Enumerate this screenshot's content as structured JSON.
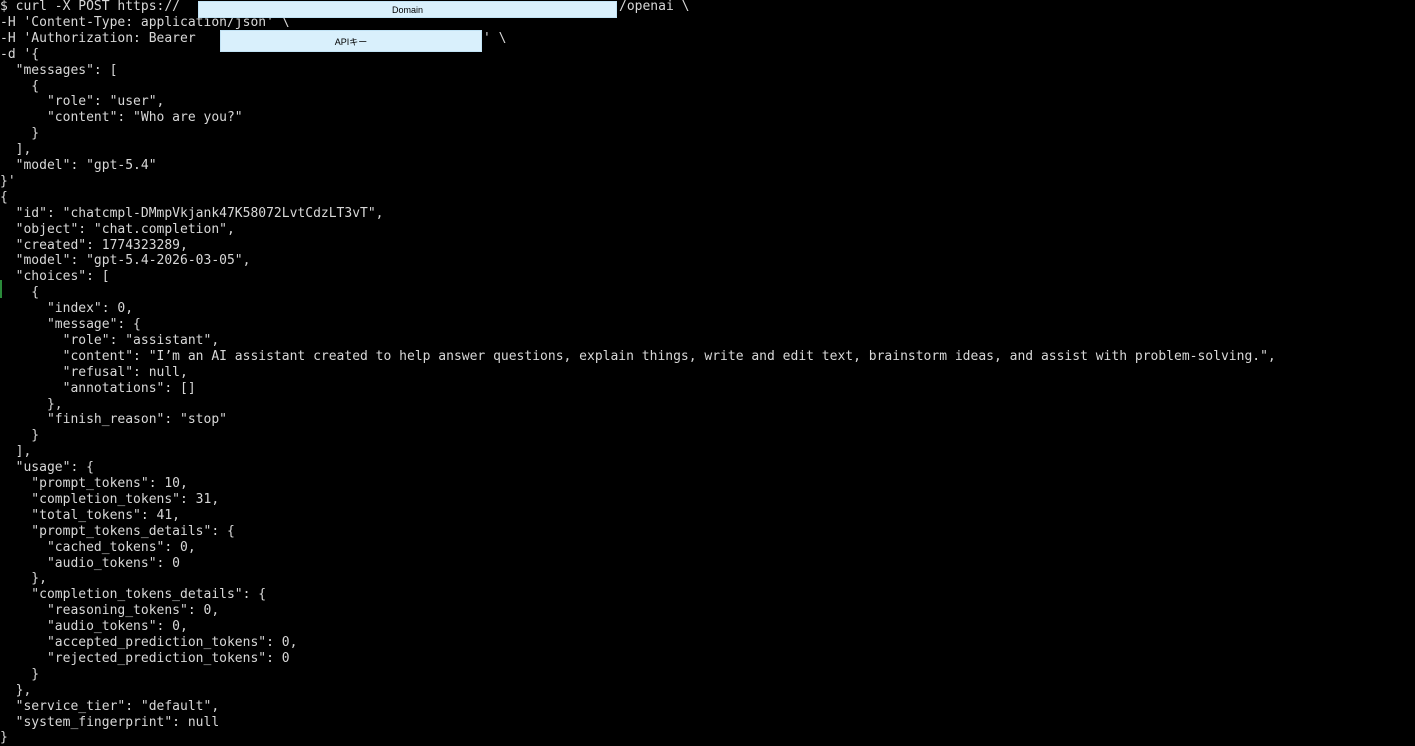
{
  "terminal": {
    "lines": [
      "$ curl -X POST https://",
      "-H 'Content-Type: application/json' \\",
      "-H 'Authorization: Bearer ",
      "-d '{",
      "  \"messages\": [",
      "    {",
      "      \"role\": \"user\",",
      "      \"content\": \"Who are you?\"",
      "    }",
      "  ],",
      "  \"model\": \"gpt-5.4\"",
      "}'",
      "{",
      "  \"id\": \"chatcmpl-DMmpVkjank47K58072LvtCdzLT3vT\",",
      "  \"object\": \"chat.completion\",",
      "  \"created\": 1774323289,",
      "  \"model\": \"gpt-5.4-2026-03-05\",",
      "  \"choices\": [",
      "    {",
      "      \"index\": 0,",
      "      \"message\": {",
      "        \"role\": \"assistant\",",
      "        \"content\": \"I’m an AI assistant created to help answer questions, explain things, write and edit text, brainstorm ideas, and assist with problem-solving.\",",
      "        \"refusal\": null,",
      "        \"annotations\": []",
      "      },",
      "      \"finish_reason\": \"stop\"",
      "    }",
      "  ],",
      "  \"usage\": {",
      "    \"prompt_tokens\": 10,",
      "    \"completion_tokens\": 31,",
      "    \"total_tokens\": 41,",
      "    \"prompt_tokens_details\": {",
      "      \"cached_tokens\": 0,",
      "      \"audio_tokens\": 0",
      "    },",
      "    \"completion_tokens_details\": {",
      "      \"reasoning_tokens\": 0,",
      "      \"audio_tokens\": 0,",
      "      \"accepted_prediction_tokens\": 0,",
      "      \"rejected_prediction_tokens\": 0",
      "    }",
      "  },",
      "  \"service_tier\": \"default\",",
      "  \"system_fingerprint\": null",
      "}"
    ],
    "line0_suffix": "/openai \\",
    "line2_suffix": "' \\"
  },
  "redactions": {
    "domain_label": "Domain",
    "api_key_label": "APIキー"
  },
  "colors": {
    "background": "#000000",
    "text": "#d8d8d8",
    "redaction": "#d9f0fc"
  }
}
